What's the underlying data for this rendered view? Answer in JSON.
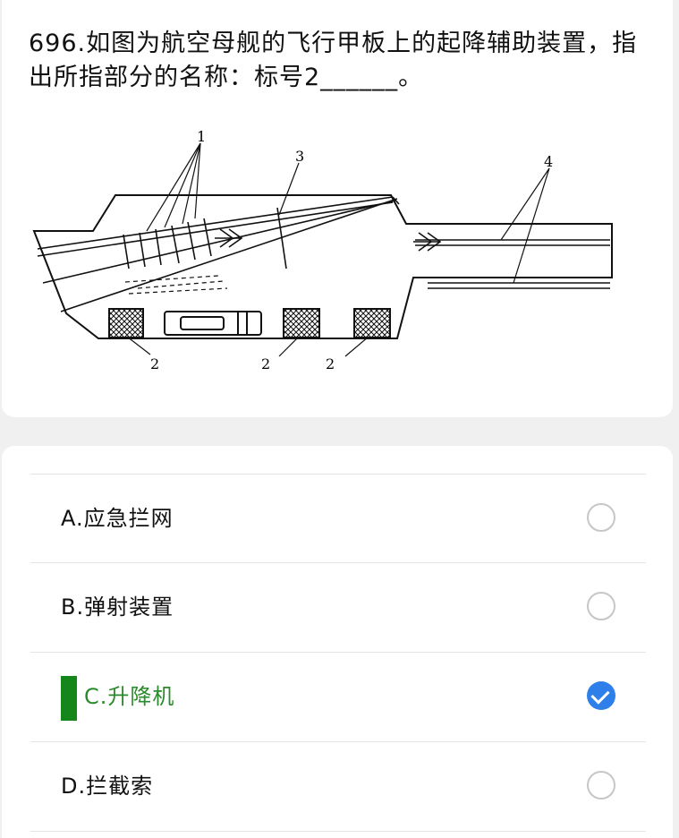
{
  "question": {
    "text": "696.如图为航空母舰的飞行甲板上的起降辅助装置，指出所指部分的名称：标号2______。"
  },
  "figure": {
    "callouts": {
      "label_1": "1",
      "label_3": "3",
      "label_4": "4",
      "label_2a": "2",
      "label_2b": "2",
      "label_2c": "2"
    }
  },
  "options": [
    {
      "label": "A.应急拦网",
      "selected": false
    },
    {
      "label": "B.弹射装置",
      "selected": false
    },
    {
      "label": "C.升降机",
      "selected": true
    },
    {
      "label": "D.拦截索",
      "selected": false
    }
  ],
  "colors": {
    "selected_bar": "#14861a",
    "selected_text": "#2b8a2b",
    "check_fill": "#2f7fea"
  }
}
